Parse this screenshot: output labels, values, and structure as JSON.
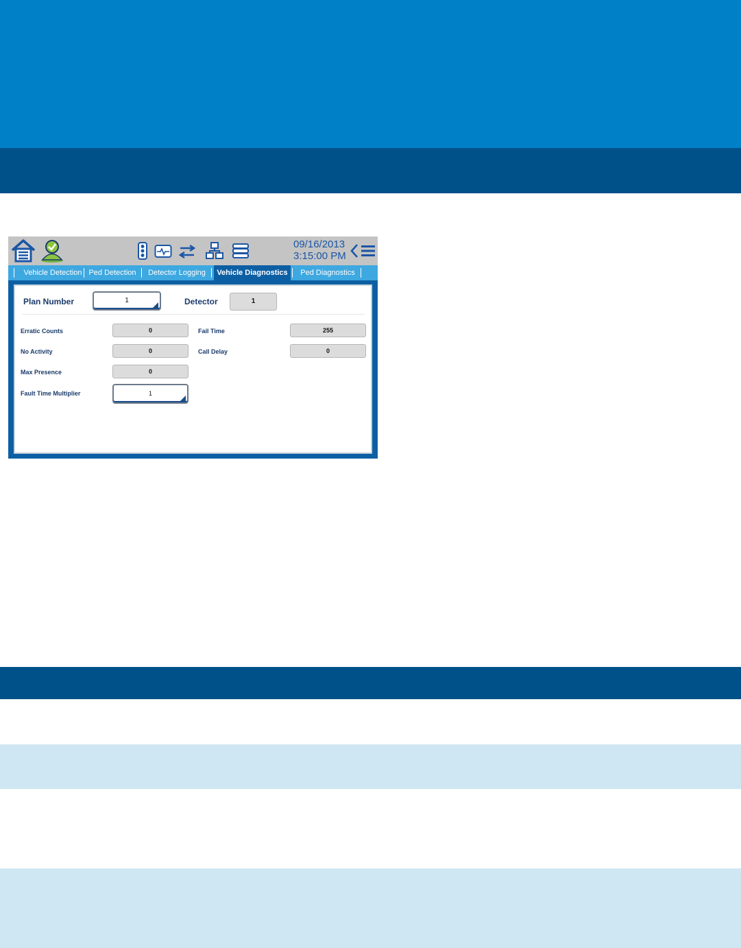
{
  "controller": {
    "datetime": {
      "date": "09/16/2013",
      "time": "3:15:00 PM"
    },
    "tabs": [
      {
        "label": "Vehicle Detection",
        "active": false
      },
      {
        "label": "Ped Detection",
        "active": false
      },
      {
        "label": "Detector Logging",
        "active": false
      },
      {
        "label": "Vehicle Diagnostics",
        "active": true
      },
      {
        "label": "Ped Diagnostics",
        "active": false
      }
    ],
    "form": {
      "plan_number": {
        "label": "Plan Number",
        "value": "1"
      },
      "detector": {
        "label": "Detector",
        "value": "1"
      },
      "erratic_counts": {
        "label": "Erratic Counts",
        "value": "0"
      },
      "no_activity": {
        "label": "No Activity",
        "value": "0"
      },
      "max_presence": {
        "label": "Max Presence",
        "value": "0"
      },
      "fault_time_multiplier": {
        "label": "Fault Time Multiplier",
        "value": "1"
      },
      "fail_time": {
        "label": "Fail Time",
        "value": "255"
      },
      "call_delay": {
        "label": "Call Delay",
        "value": "0"
      }
    },
    "icons": [
      "home-icon",
      "user-location-icon",
      "traffic-signal-icon",
      "monitor-pulse-icon",
      "transfer-icon",
      "network-icon",
      "list-icon",
      "back-chevron-icon",
      "menu-icon"
    ]
  },
  "colors": {
    "hero_blue": "#0080c6",
    "dark_blue": "#00518a",
    "light_stripe": "#cfe6f3",
    "tab_bar": "#3ea8e0",
    "active_tab": "#0d5fa4"
  }
}
